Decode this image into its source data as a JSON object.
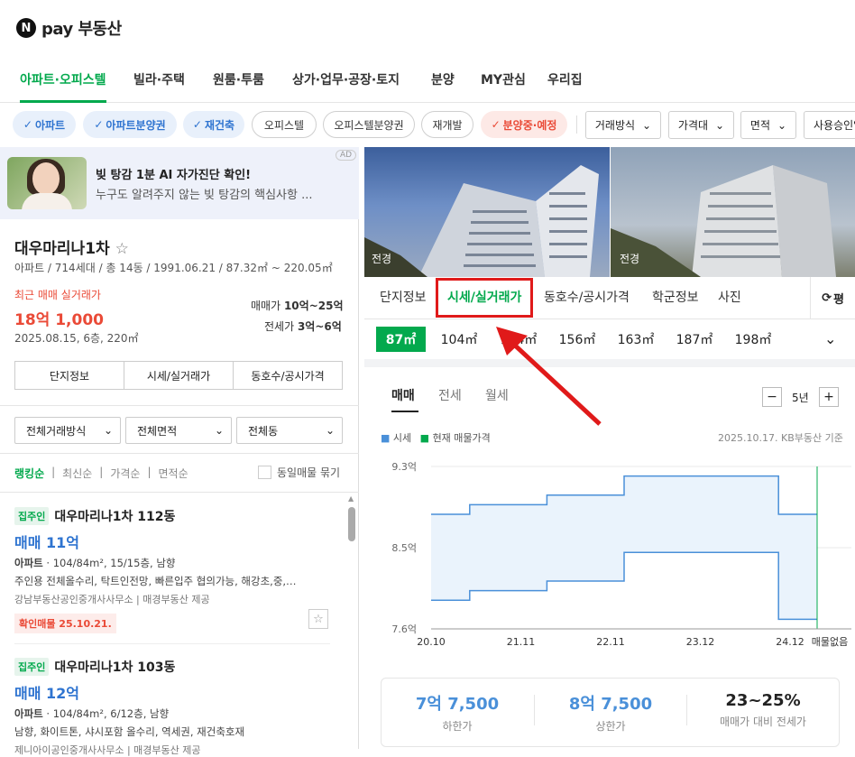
{
  "brand": {
    "logo_letter": "N",
    "name": "pay 부동산"
  },
  "nav": [
    "아파트·오피스텔",
    "빌라·주택",
    "원룸·투룸",
    "상가·업무·공장·토지",
    "분양",
    "MY관심",
    "우리집"
  ],
  "filters": {
    "chips": [
      "아파트",
      "아파트분양권",
      "재건축",
      "오피스텔",
      "오피스텔분양권",
      "재개발",
      "분양중·예정"
    ],
    "dropdowns": [
      "거래방식",
      "가격대",
      "면적",
      "사용승인일"
    ]
  },
  "ad": {
    "badge": "AD",
    "title": "빚 탕감 1분 AI 자가진단 확인!",
    "desc": "누구도 알려주지 않는 빚 탕감의 핵심사항 ..."
  },
  "complex": {
    "name": "대우마리나1차",
    "info": "아파트 / 714세대 / 총 14동 / 1991.06.21 / 87.32㎡ ~ 220.05㎡",
    "recent_label": "최근 매매 실거래가",
    "recent_price": "18억 1,000",
    "recent_date": "2025.08.15, 6층, 220㎡",
    "sale_label": "매매가",
    "sale_range": "10억~25억",
    "jeonse_label": "전세가",
    "jeonse_range": "3억~6억",
    "buttons": [
      "단지정보",
      "시세/실거래가",
      "동호수/공시가격"
    ]
  },
  "left_filters": [
    "전체거래방식",
    "전체면적",
    "전체동"
  ],
  "sort": {
    "options": [
      "랭킹순",
      "최신순",
      "가격순",
      "면적순"
    ],
    "group_label": "동일매물 묶기"
  },
  "listings": [
    {
      "tag": "집주인",
      "title": "대우마리나1차 112동",
      "price": "매매 11억",
      "type": "아파트",
      "spec": "104/84m², 15/15층, 남향",
      "desc": "주인용 전체올수리, 탁트인전망, 빠른입주 협의가능, 해강초,중,…",
      "agency": "강남부동산공인중개사사무소",
      "provider": "매경부동산 제공",
      "confirm": "확인매물 25.10.21."
    },
    {
      "tag": "집주인",
      "title": "대우마리나1차 103동",
      "price": "매매 12억",
      "type": "아파트",
      "spec": "104/84m², 6/12층, 남향",
      "desc": "남향, 화이트톤, 샤시포함 올수리, 역세권, 재건축호재",
      "agency": "제니아이공인중개사사무소",
      "provider": "매경부동산 제공"
    }
  ],
  "photos": [
    "전경",
    "전경"
  ],
  "tabs": [
    "단지정보",
    "시세/실거래가",
    "동호수/공시가격",
    "학군정보",
    "사진"
  ],
  "tab_right": "평",
  "areas": [
    "87㎡",
    "104㎡",
    "104㎡",
    "156㎡",
    "163㎡",
    "187㎡",
    "198㎡"
  ],
  "deal_tabs": [
    "매매",
    "전세",
    "월세"
  ],
  "period": {
    "value": "5년",
    "minus": "−",
    "plus": "+"
  },
  "legend": {
    "market": "시세",
    "current": "현재 매물가격",
    "source": "2025.10.17. KB부동산 기준"
  },
  "chart_data": {
    "type": "area",
    "y_ticks": [
      "9.3억",
      "8.5억",
      "7.6억"
    ],
    "ylim": [
      7.6,
      9.3
    ],
    "x_ticks": [
      "20.10",
      "21.11",
      "22.11",
      "23.12",
      "24.12"
    ],
    "no_listing_label": "매물없음",
    "series": [
      {
        "name": "",
        "upper": [
          8.8,
          8.9,
          8.9,
          9.0,
          9.0,
          9.2,
          9.2,
          9.2,
          9.2,
          8.8,
          8.8
        ],
        "lower": [
          7.9,
          8.0,
          8.0,
          8.1,
          8.1,
          8.4,
          8.4,
          8.4,
          8.4,
          7.7,
          7.7
        ]
      }
    ]
  },
  "stats": [
    {
      "value": "7억 7,500",
      "label": "하한가",
      "color": "#4a90d9"
    },
    {
      "value": "8억 7,500",
      "label": "상한가",
      "color": "#4a90d9"
    },
    {
      "value": "23~25%",
      "label": "매매가 대비 전세가",
      "color": "#222"
    }
  ]
}
